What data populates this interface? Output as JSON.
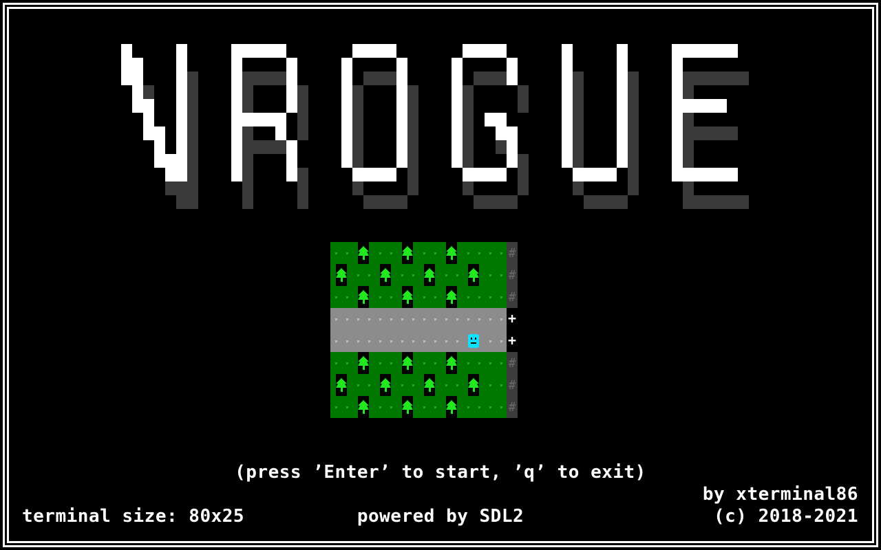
{
  "title": "NROGUE",
  "colors": {
    "background": "#000000",
    "text": "#ffffff",
    "logo": "#ffffff",
    "logo_shadow": "#3a3a3a",
    "grass": "#007800",
    "grass_dot": "#2aa82a",
    "tree": "#22e822",
    "road": "#8c8c8c",
    "road_dot": "#bdbdbd",
    "wall": "#3c3c3c",
    "player": "#10e0ff"
  },
  "preview_map": {
    "rows": [
      ".t.t.t..#",
      "t.t.t.t.#",
      ".t.t.t..#",
      "........+",
      "......@.+",
      ".t.t.t..#",
      "t.t.t.t.#",
      ".t.t.t..#"
    ],
    "legend": {
      ".": "grass",
      "t": "tree-icon",
      "#": "wall",
      "+": "door",
      "@": "player-icon"
    }
  },
  "prompt_text": "(press ’Enter’ to start, ’q’ to exit)",
  "author_text": "by xterminal86",
  "terminal_size_text": "terminal size: 80x25",
  "powered_text": "powered by SDL2",
  "copyright_text": "(c) 2018-2021"
}
